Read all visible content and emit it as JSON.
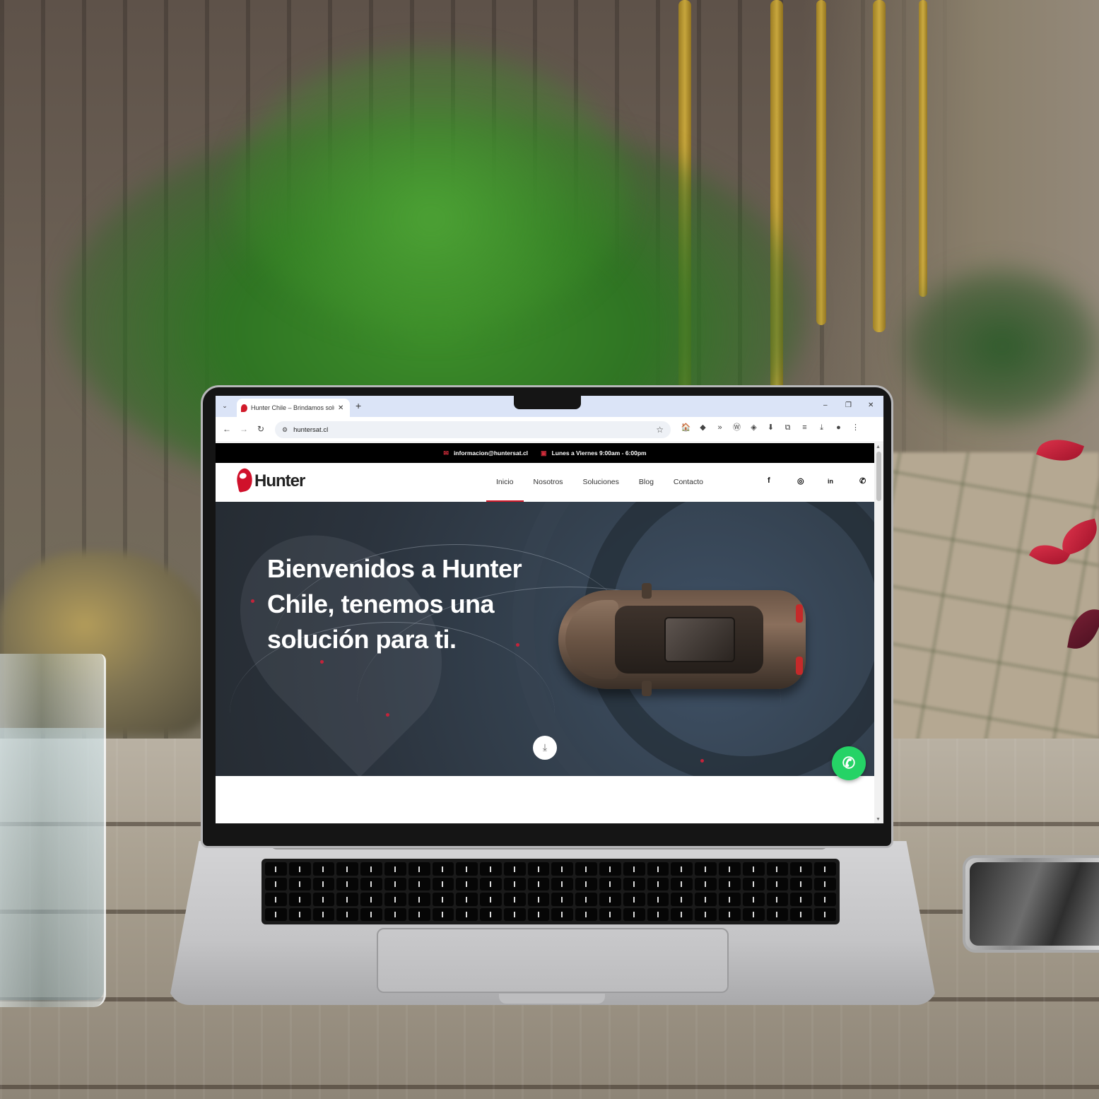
{
  "browser": {
    "tab_title": "Hunter Chile – Brindamos soluc",
    "tab_close": "✕",
    "new_tab": "+",
    "tab_list": "⌄",
    "window_controls": {
      "minimize": "–",
      "restore": "❐",
      "close": "✕"
    },
    "nav": {
      "back": "←",
      "forward": "→",
      "reload": "↻"
    },
    "url": "huntersat.cl",
    "site_info_icon": "⚙",
    "bookmark_icon": "☆",
    "extensions": [
      "🏠",
      "◆",
      "»",
      "Ⓦ",
      "◈",
      "⬇",
      "⧉",
      "≡",
      "⤓",
      "●",
      "⋮"
    ]
  },
  "topbar": {
    "email_icon": "✉",
    "email": "informacion@huntersat.cl",
    "hours_icon": "▣",
    "hours": "Lunes a Viernes 9:00am - 6:00pm"
  },
  "site": {
    "logo_text": "Hunter",
    "nav": [
      "Inicio",
      "Nosotros",
      "Soluciones",
      "Blog",
      "Contacto"
    ],
    "active_nav": "Inicio",
    "social": {
      "facebook": "f",
      "instagram": "◎",
      "linkedin": "in",
      "whatsapp": "✆"
    }
  },
  "hero": {
    "title": "Bienvenidos a Hunter Chile, tenemos una solución para ti.",
    "scroll_icon": "⤓",
    "whatsapp_icon": "✆"
  },
  "colors": {
    "brand_red": "#d11a2a",
    "whatsapp_green": "#25d366",
    "hero_bg": "#2b333d"
  }
}
